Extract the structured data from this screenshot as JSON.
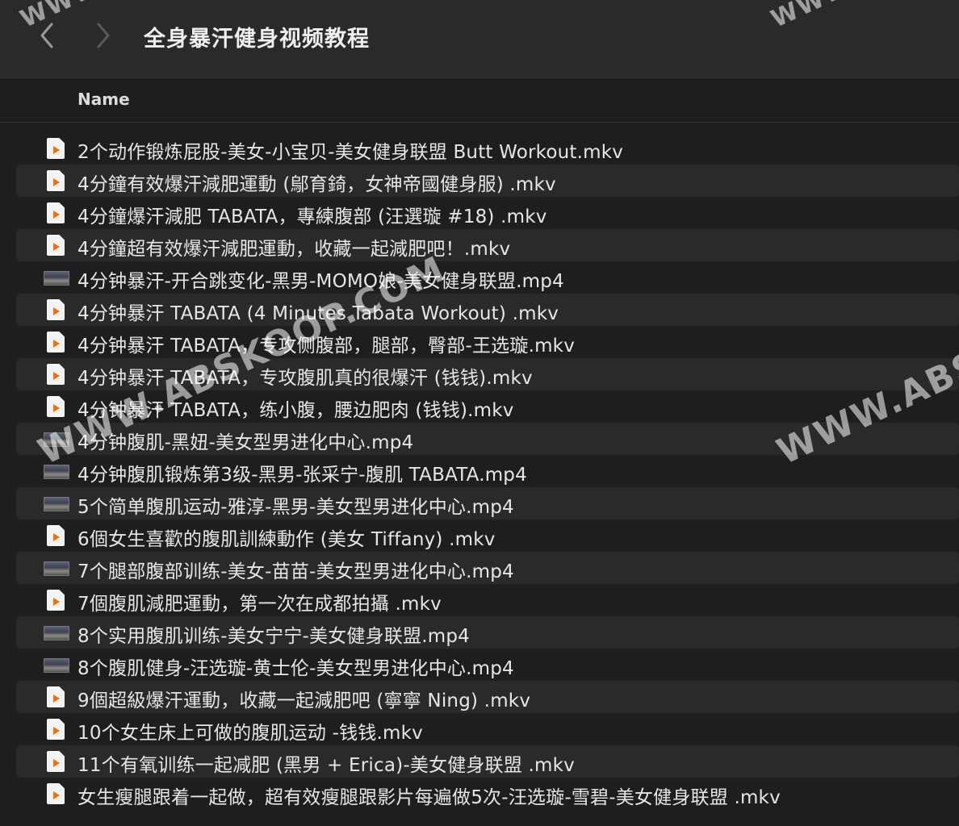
{
  "window": {
    "title": "全身暴汗健身视频教程",
    "nav": {
      "back_icon": "chevron-left-icon",
      "forward_icon": "chevron-right-icon"
    }
  },
  "list_header": {
    "name": "Name"
  },
  "files": [
    {
      "name": "2个动作锻炼屁股-美女-小宝贝-美女健身联盟 Butt Workout.mkv",
      "icon": "mkv-file-icon"
    },
    {
      "name": "4分鐘有效爆汗減肥運動 (鄔育錡，女神帝國健身服) .mkv",
      "icon": "mkv-file-icon"
    },
    {
      "name": "4分鐘爆汗減肥 TABATA，專練腹部 (汪選璇 #18) .mkv",
      "icon": "mkv-file-icon"
    },
    {
      "name": "4分鐘超有效爆汗減肥運動，收藏一起減肥吧！.mkv",
      "icon": "mkv-file-icon"
    },
    {
      "name": "4分钟暴汗-开合跳变化-黑男-MOMO娘-美女健身联盟.mp4",
      "icon": "video-thumbnail-icon"
    },
    {
      "name": "4分钟暴汗 TABATA (4 Minutes Tabata Workout) .mkv",
      "icon": "mkv-file-icon"
    },
    {
      "name": "4分钟暴汗 TABATA，专攻侧腹部，腿部，臀部-王选璇.mkv",
      "icon": "mkv-file-icon"
    },
    {
      "name": "4分钟暴汗 TABATA，专攻腹肌真的很爆汗 (钱钱).mkv",
      "icon": "mkv-file-icon"
    },
    {
      "name": "4分钟暴汗 TABATA，练小腹，腰边肥肉 (钱钱).mkv",
      "icon": "mkv-file-icon"
    },
    {
      "name": "4分钟腹肌-黑妞-美女型男进化中心.mp4",
      "icon": "video-thumbnail-icon"
    },
    {
      "name": "4分钟腹肌锻炼第3级-黑男-张采宁-腹肌 TABATA.mp4",
      "icon": "video-thumbnail-icon"
    },
    {
      "name": "5个简单腹肌运动-雅淳-黑男-美女型男进化中心.mp4",
      "icon": "video-thumbnail-icon"
    },
    {
      "name": "6個女生喜歡的腹肌訓練動作 (美女 Tiffany) .mkv",
      "icon": "mkv-file-icon"
    },
    {
      "name": "7个腿部腹部训练-美女-苗苗-美女型男进化中心.mp4",
      "icon": "video-thumbnail-icon"
    },
    {
      "name": "7個腹肌減肥運動，第一次在成都拍攝 .mkv",
      "icon": "mkv-file-icon"
    },
    {
      "name": "8个实用腹肌训练-美女宁宁-美女健身联盟.mp4",
      "icon": "video-thumbnail-icon"
    },
    {
      "name": "8个腹肌健身-汪选璇-黄士伦-美女型男进化中心.mp4",
      "icon": "video-thumbnail-icon"
    },
    {
      "name": "9個超級爆汗運動，收藏一起減肥吧 (寧寧 Ning) .mkv",
      "icon": "mkv-file-icon"
    },
    {
      "name": "10个女生床上可做的腹肌运动 -钱钱.mkv",
      "icon": "mkv-file-icon"
    },
    {
      "name": "11个有氧训练一起减肥 (黑男 + Erica)-美女健身联盟 .mkv",
      "icon": "mkv-file-icon"
    },
    {
      "name": "女生瘦腿跟着一起做，超有效瘦腿跟影片每遍做5次-汪选璇-雪碧-美女健身联盟 .mkv",
      "icon": "mkv-file-icon"
    }
  ],
  "watermarks": [
    "WWW.ABSKOOP.COM",
    "WWW.ABSKO",
    "WWW.A",
    "WWW."
  ],
  "colors": {
    "background": "#1e1e1e",
    "titlebar": "#2b2929",
    "row_alt": "#2a2a2a",
    "play_accent": "#e4731c"
  }
}
